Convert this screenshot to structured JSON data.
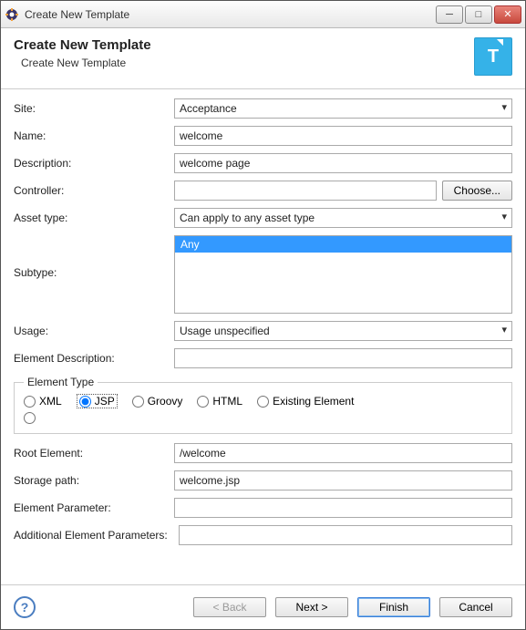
{
  "window": {
    "title": "Create New Template"
  },
  "header": {
    "title": "Create New Template",
    "subtitle": "Create New Template",
    "iconLetter": "T"
  },
  "labels": {
    "site": "Site:",
    "name": "Name:",
    "description": "Description:",
    "controller": "Controller:",
    "assetType": "Asset type:",
    "subtype": "Subtype:",
    "usage": "Usage:",
    "elementDescription": "Element Description:",
    "elementType": "Element Type",
    "rootElement": "Root Element:",
    "storagePath": "Storage path:",
    "elementParameter": "Element Parameter:",
    "additionalElementParameters": "Additional Element Parameters:"
  },
  "values": {
    "site": "Acceptance",
    "name": "welcome",
    "description": "welcome page",
    "controller": "",
    "assetType": "Can apply to any asset type",
    "subtypeOptions": [
      "Any"
    ],
    "subtypeSelected": "Any",
    "usage": "Usage unspecified",
    "elementDescription": "",
    "rootElement": "/welcome",
    "storagePath": "welcome.jsp",
    "elementParameter": "",
    "additionalElementParameters": ""
  },
  "radios": {
    "xml": "XML",
    "jsp": "JSP",
    "groovy": "Groovy",
    "html": "HTML",
    "existing": "Existing Element"
  },
  "buttons": {
    "choose": "Choose...",
    "back": "< Back",
    "next": "Next >",
    "finish": "Finish",
    "cancel": "Cancel"
  },
  "help": "?"
}
